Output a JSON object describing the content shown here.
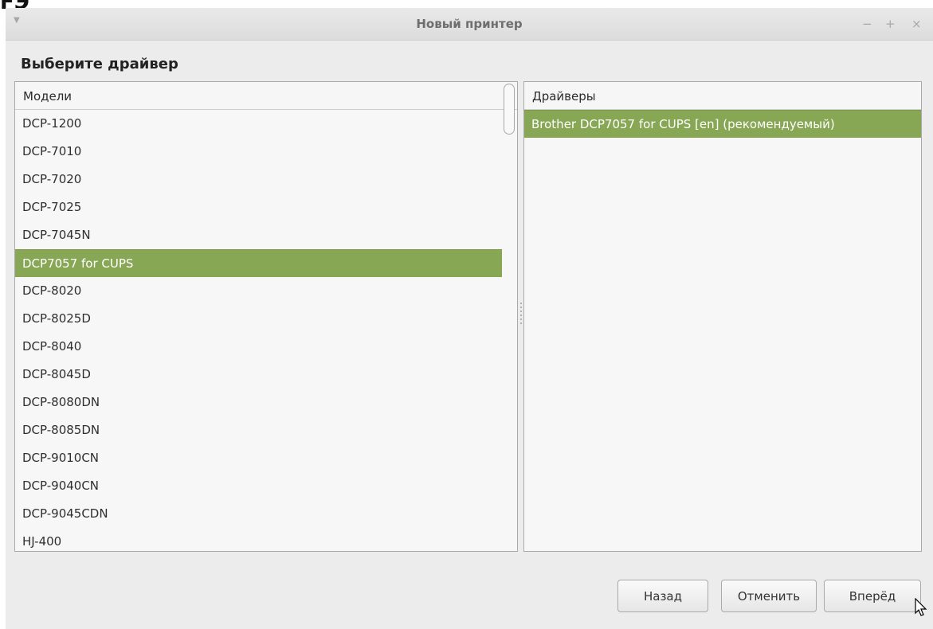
{
  "background_fragment": "FЭ",
  "window": {
    "title": "Новый принтер",
    "controls": {
      "minimize": "−",
      "maximize": "+",
      "close": "×"
    }
  },
  "heading": "Выберите драйвер",
  "models": {
    "header": "Модели",
    "items": [
      "DCP-1200",
      "DCP-7010",
      "DCP-7020",
      "DCP-7025",
      "DCP-7045N",
      "DCP7057 for CUPS",
      "DCP-8020",
      "DCP-8025D",
      "DCP-8040",
      "DCP-8045D",
      "DCP-8080DN",
      "DCP-8085DN",
      "DCP-9010CN",
      "DCP-9040CN",
      "DCP-9045CDN",
      "HJ-400"
    ],
    "selected_index": 5
  },
  "drivers": {
    "header": "Драйверы",
    "items": [
      "Brother DCP7057 for CUPS [en] (рекомендуемый)"
    ],
    "selected_index": 0
  },
  "buttons": {
    "back": "Назад",
    "cancel": "Отменить",
    "forward": "Вперёд"
  },
  "colors": {
    "selection": "#87a754",
    "window_bg": "#ececec"
  },
  "icons": {
    "menu": "window-menu-arrow-icon",
    "cursor": "mouse-pointer-icon"
  }
}
